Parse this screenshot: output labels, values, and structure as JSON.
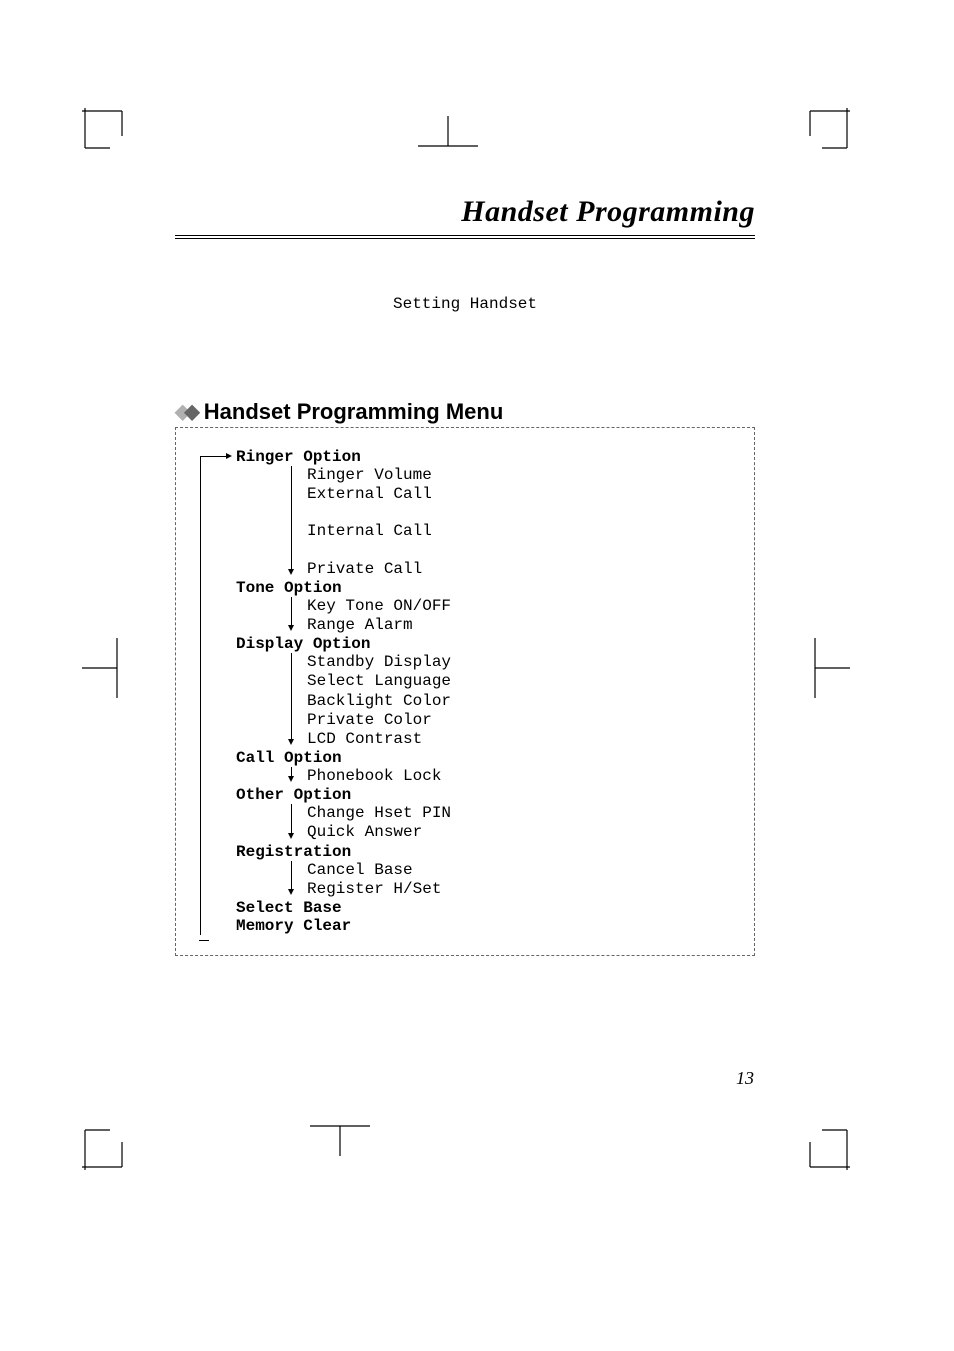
{
  "title": "Handset Programming",
  "breadcrumb": "Setting Handset",
  "section_header": "Handset Programming Menu",
  "menu": {
    "ringer": {
      "label": "Ringer Option",
      "items": {
        "volume": "Ringer Volume",
        "external": "External Call",
        "internal": "Internal Call",
        "private": "Private Call"
      }
    },
    "tone": {
      "label": "Tone Option",
      "items": {
        "keytone": "Key Tone ON/OFF",
        "rangealarm": "Range Alarm"
      }
    },
    "display": {
      "label": "Display Option",
      "items": {
        "standby": "Standby Display",
        "language": "Select Language",
        "backlight": "Backlight Color",
        "privatecolor": "Private Color",
        "contrast": "LCD Contrast"
      }
    },
    "call": {
      "label": "Call Option",
      "items": {
        "pblock": "Phonebook Lock"
      }
    },
    "other": {
      "label": "Other Option",
      "items": {
        "changepin": "Change Hset PIN",
        "quickanswer": "Quick Answer"
      }
    },
    "registration": {
      "label": "Registration",
      "items": {
        "cancelbase": "Cancel Base",
        "register": "Register H/Set"
      }
    },
    "selectbase": {
      "label": "Select Base"
    },
    "memoryclear": {
      "label": "Memory Clear"
    }
  },
  "page_number": "13"
}
